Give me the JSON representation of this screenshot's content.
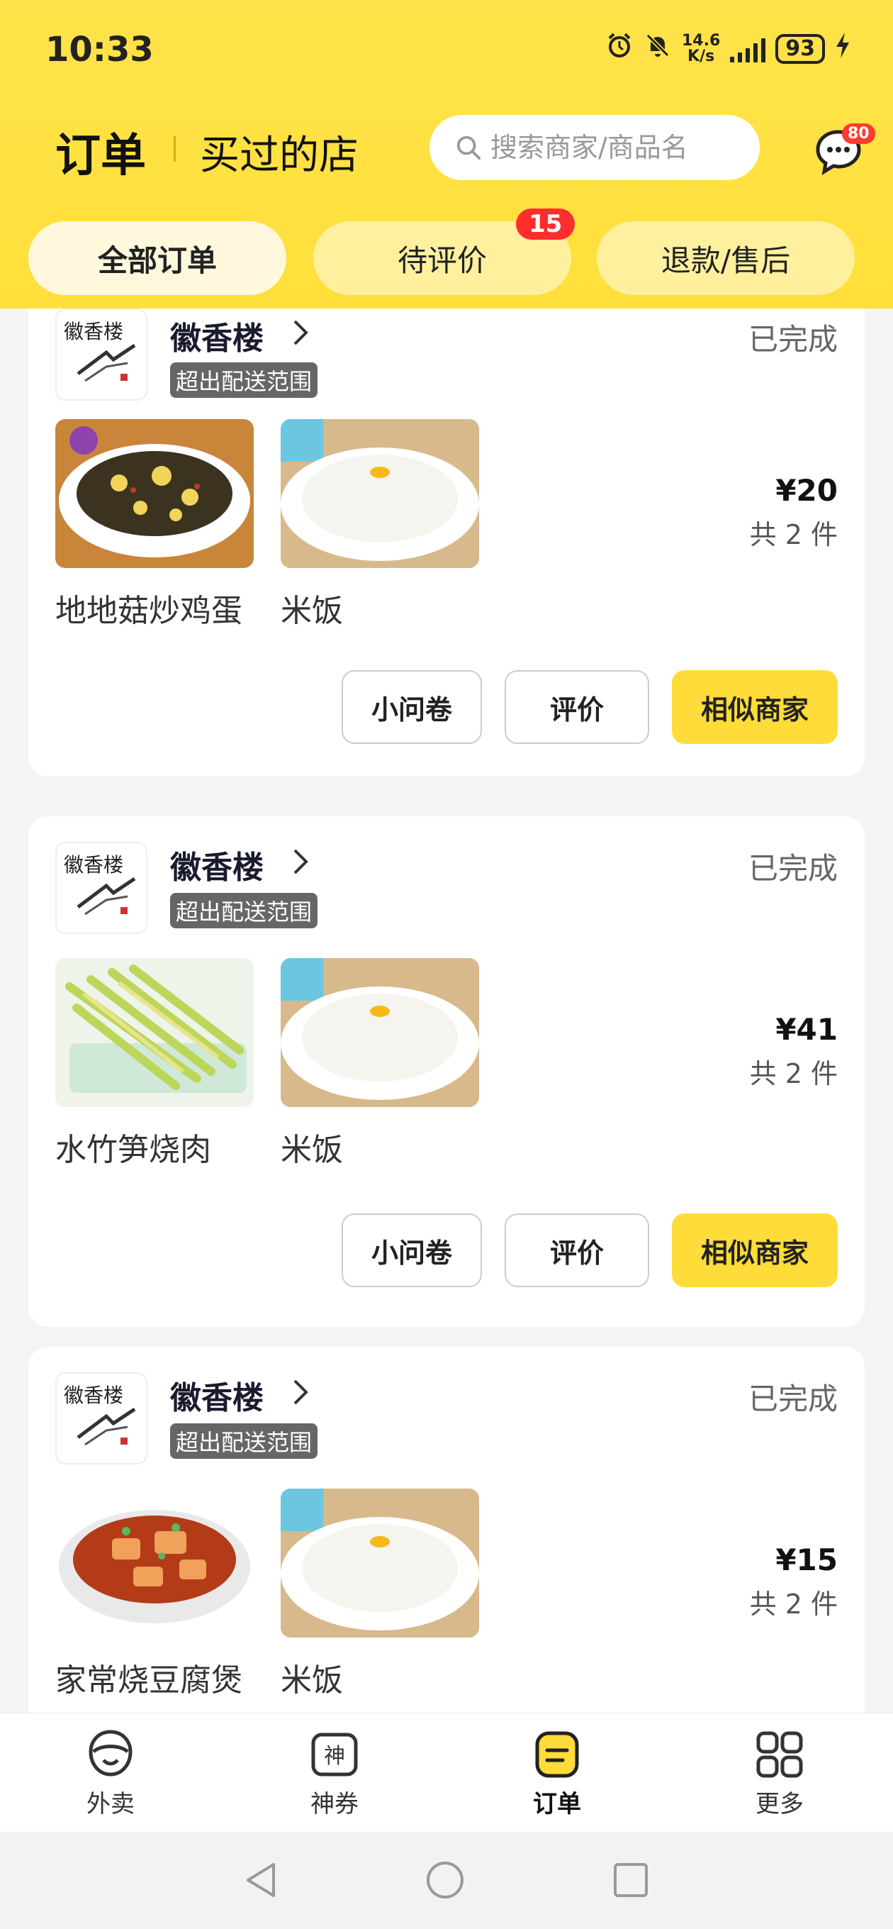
{
  "status_bar": {
    "time": "10:33",
    "net_speed_top": "14.6",
    "net_speed_bottom": "K/s",
    "battery": "93"
  },
  "header": {
    "title": "订单",
    "subtitle": "买过的店",
    "search_placeholder": "搜索商家/商品名",
    "message_badge": "80"
  },
  "tabs": [
    {
      "label": "全部订单"
    },
    {
      "label": "待评价",
      "badge": "15"
    },
    {
      "label": "退款/售后"
    }
  ],
  "orders": [
    {
      "shop_name": "徽香楼",
      "tag": "超出配送范围",
      "status": "已完成",
      "items": [
        "地地菇炒鸡蛋",
        "米饭"
      ],
      "price": "¥20",
      "count": "共 2 件",
      "buttons": [
        "小问卷",
        "评价",
        "相似商家"
      ]
    },
    {
      "shop_name": "徽香楼",
      "tag": "超出配送范围",
      "status": "已完成",
      "items": [
        "水竹笋烧肉",
        "米饭"
      ],
      "price": "¥41",
      "count": "共 2 件",
      "buttons": [
        "小问卷",
        "评价",
        "相似商家"
      ]
    },
    {
      "shop_name": "徽香楼",
      "tag": "超出配送范围",
      "status": "已完成",
      "items": [
        "家常烧豆腐煲",
        "米饭"
      ],
      "price": "¥15",
      "count": "共 2 件"
    }
  ],
  "bottom_nav": [
    {
      "label": "外卖",
      "icon": "takeout-icon"
    },
    {
      "label": "神券",
      "icon": "coupon-icon"
    },
    {
      "label": "订单",
      "icon": "orders-icon",
      "active": true
    },
    {
      "label": "更多",
      "icon": "grid-icon"
    }
  ],
  "colors": {
    "brand_yellow": "#ffdf3a",
    "badge_red": "#ff2d2d"
  }
}
